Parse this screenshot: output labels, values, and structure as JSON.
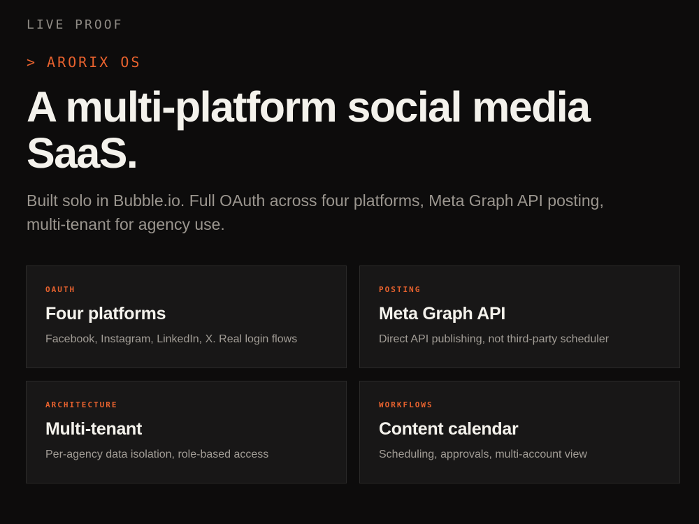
{
  "colors": {
    "background": "#0d0c0c",
    "card_background": "#181717",
    "card_border": "#2b2a29",
    "accent": "#e8622e",
    "heading": "#f4f2ec",
    "muted_text": "#9b968f"
  },
  "eyebrow": "LIVE PROOF",
  "project": {
    "prompt": ">",
    "name": "ARORIX OS"
  },
  "headline": "A multi-platform social media SaaS.",
  "subtitle": "Built solo in Bubble.io. Full OAuth across four platforms, Meta Graph API posting, multi-tenant for agency use.",
  "cards": [
    {
      "category": "OAUTH",
      "title": "Four platforms",
      "description": "Facebook, Instagram, LinkedIn, X. Real login flows"
    },
    {
      "category": "POSTING",
      "title": "Meta Graph API",
      "description": "Direct API publishing, not third-party scheduler"
    },
    {
      "category": "ARCHITECTURE",
      "title": "Multi-tenant",
      "description": "Per-agency data isolation, role-based access"
    },
    {
      "category": "WORKFLOWS",
      "title": "Content calendar",
      "description": "Scheduling, approvals, multi-account view"
    }
  ]
}
